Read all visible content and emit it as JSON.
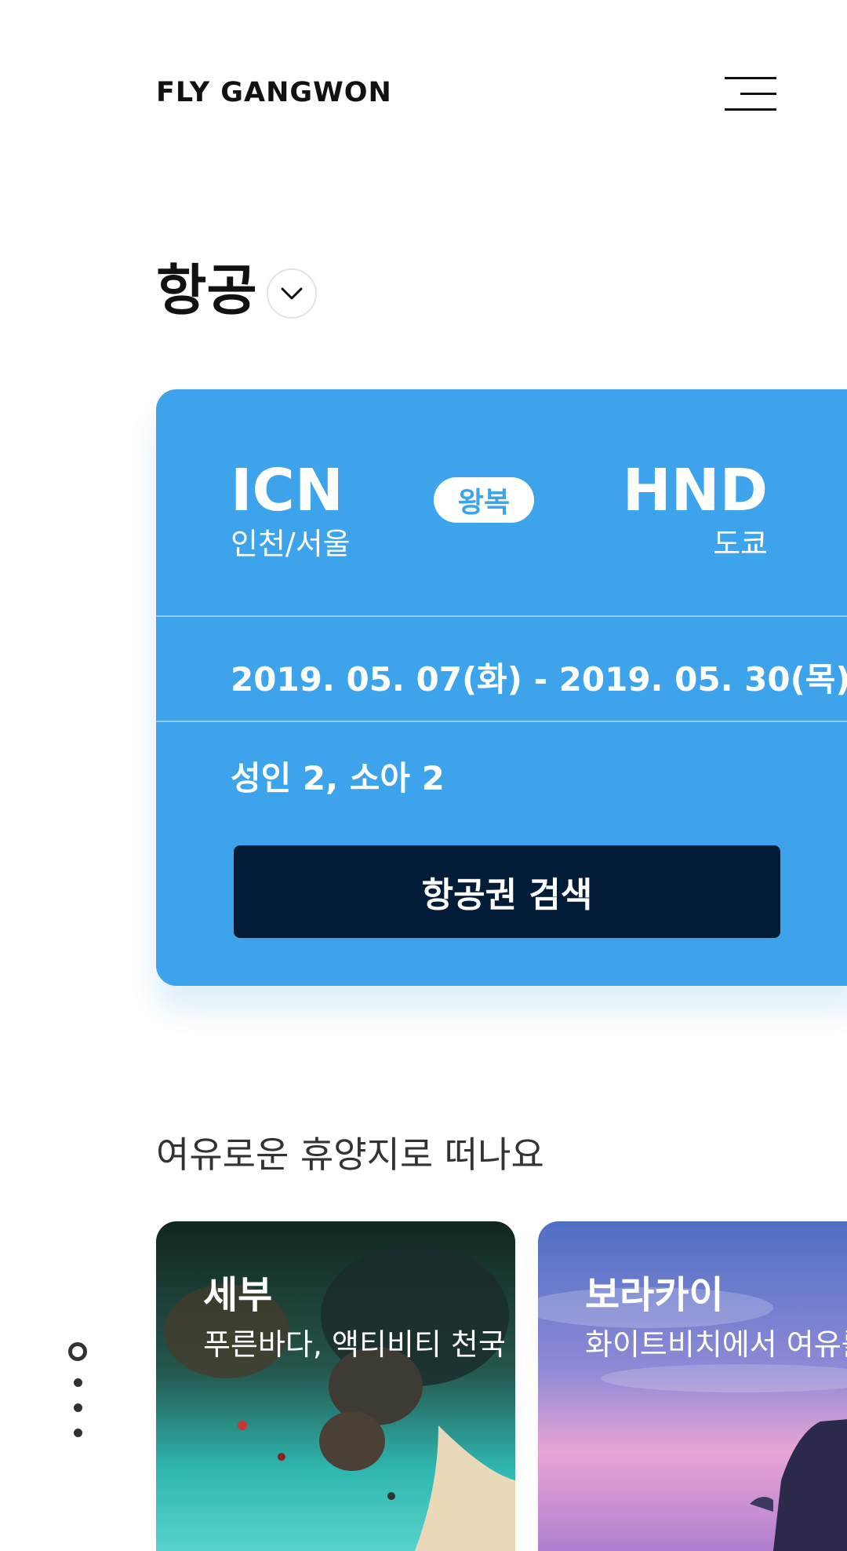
{
  "header": {
    "logo_text": "FLY GANGWON",
    "menu_icon": "hamburger-menu-icon"
  },
  "section": {
    "title": "항공",
    "dropdown_icon": "chevron-down-icon"
  },
  "booking": {
    "origin": {
      "code": "ICN",
      "city": "인천/서울"
    },
    "destination": {
      "code": "HND",
      "city": "도쿄"
    },
    "trip_type": "왕복",
    "dates": "2019. 05. 07(화) - 2019. 05. 30(목)",
    "passengers": "성인 2, 소아 2",
    "search_label": "항공권 검색",
    "accent_color": "#3da4eb",
    "button_color": "#021c38"
  },
  "destinations": {
    "heading": "여유로운 휴양지로 떠나요",
    "items": [
      {
        "name": "세부",
        "description": "푸른바다, 액티비티 천국"
      },
      {
        "name": "보라카이",
        "description": "화이트비치에서 여유를"
      }
    ]
  },
  "pagination": {
    "total": 3,
    "active_index": 0
  }
}
